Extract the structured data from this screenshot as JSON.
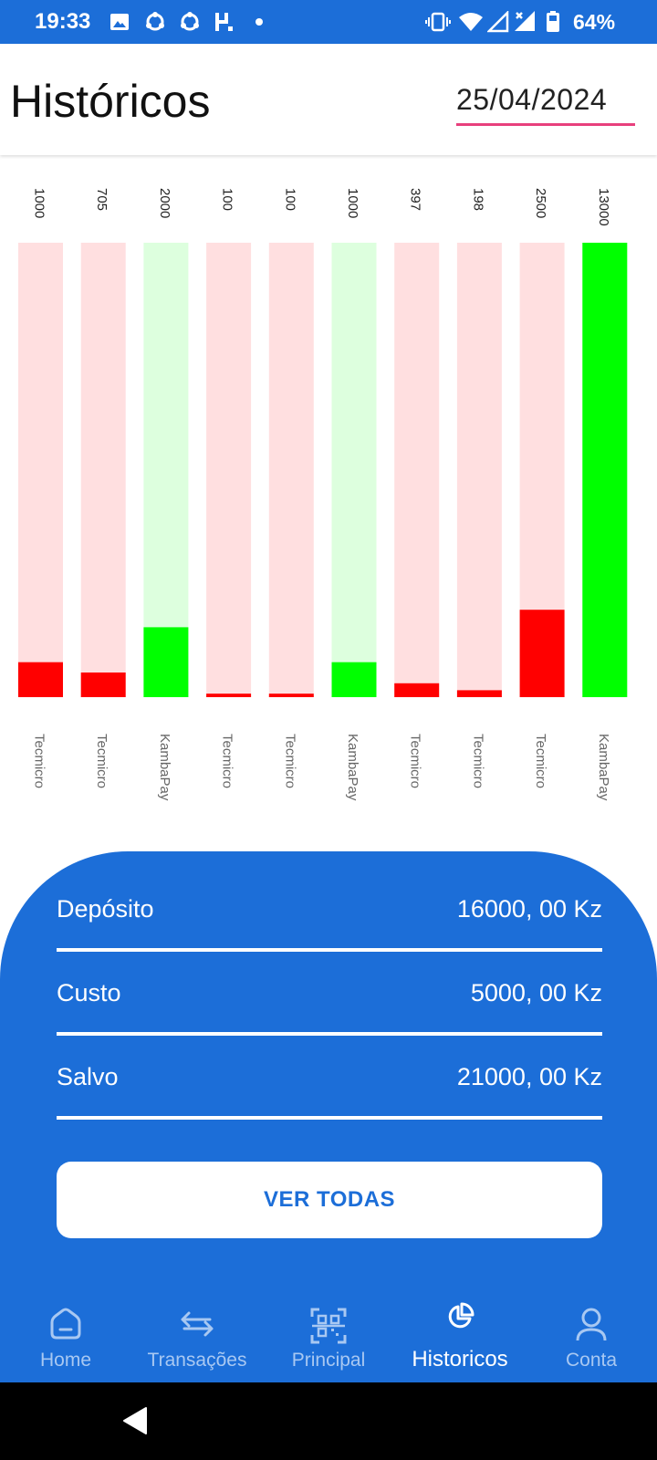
{
  "status_bar": {
    "time": "19:33",
    "battery": "64%",
    "icons": [
      "image-icon",
      "sync-icon",
      "sync-icon",
      "h-notification-icon",
      "dot-icon",
      "vibrate-icon",
      "wifi-icon",
      "signal-icon",
      "signal-x-icon",
      "battery-icon"
    ]
  },
  "header": {
    "title": "Históricos",
    "date": "25/04/2024"
  },
  "chart_data": {
    "type": "bar",
    "categories": [
      "Tecmicro",
      "Tecmicro",
      "KambaPay",
      "Tecmicro",
      "Tecmicro",
      "KambaPay",
      "Tecmicro",
      "Tecmicro",
      "Tecmicro",
      "KambaPay"
    ],
    "values": [
      1000,
      705,
      2000,
      100,
      100,
      1000,
      397,
      198,
      2500,
      13000
    ],
    "value_labels": [
      "1000",
      "705",
      "2000",
      "100",
      "100",
      "1000",
      "397",
      "198",
      "2500",
      "13000"
    ],
    "kinds": [
      "cost",
      "cost",
      "deposit",
      "cost",
      "cost",
      "deposit",
      "cost",
      "cost",
      "cost",
      "deposit"
    ],
    "ylim": [
      0,
      13000
    ],
    "colors": {
      "cost": "#ff0000",
      "cost_track": "#ffdfe0",
      "deposit": "#00ff00",
      "deposit_track": "#ddffde"
    }
  },
  "summary": {
    "rows": [
      {
        "label": "Depósito",
        "value": "16000, 00 Kz"
      },
      {
        "label": "Custo",
        "value": "5000, 00 Kz"
      },
      {
        "label": "Salvo",
        "value": "21000, 00 Kz"
      }
    ],
    "button": "VER TODAS"
  },
  "nav": {
    "items": [
      {
        "label": "Home",
        "icon": "home-icon"
      },
      {
        "label": "Transações",
        "icon": "transfer-icon"
      },
      {
        "label": "Principal",
        "icon": "qr-scan-icon"
      },
      {
        "label": "Historicos",
        "icon": "pie-chart-icon"
      },
      {
        "label": "Conta",
        "icon": "user-icon"
      }
    ],
    "active": "Historicos"
  },
  "colors": {
    "primary": "#1c6ed8",
    "date_underline": "#e8407d",
    "nav_inactive": "#a8c8f2"
  }
}
